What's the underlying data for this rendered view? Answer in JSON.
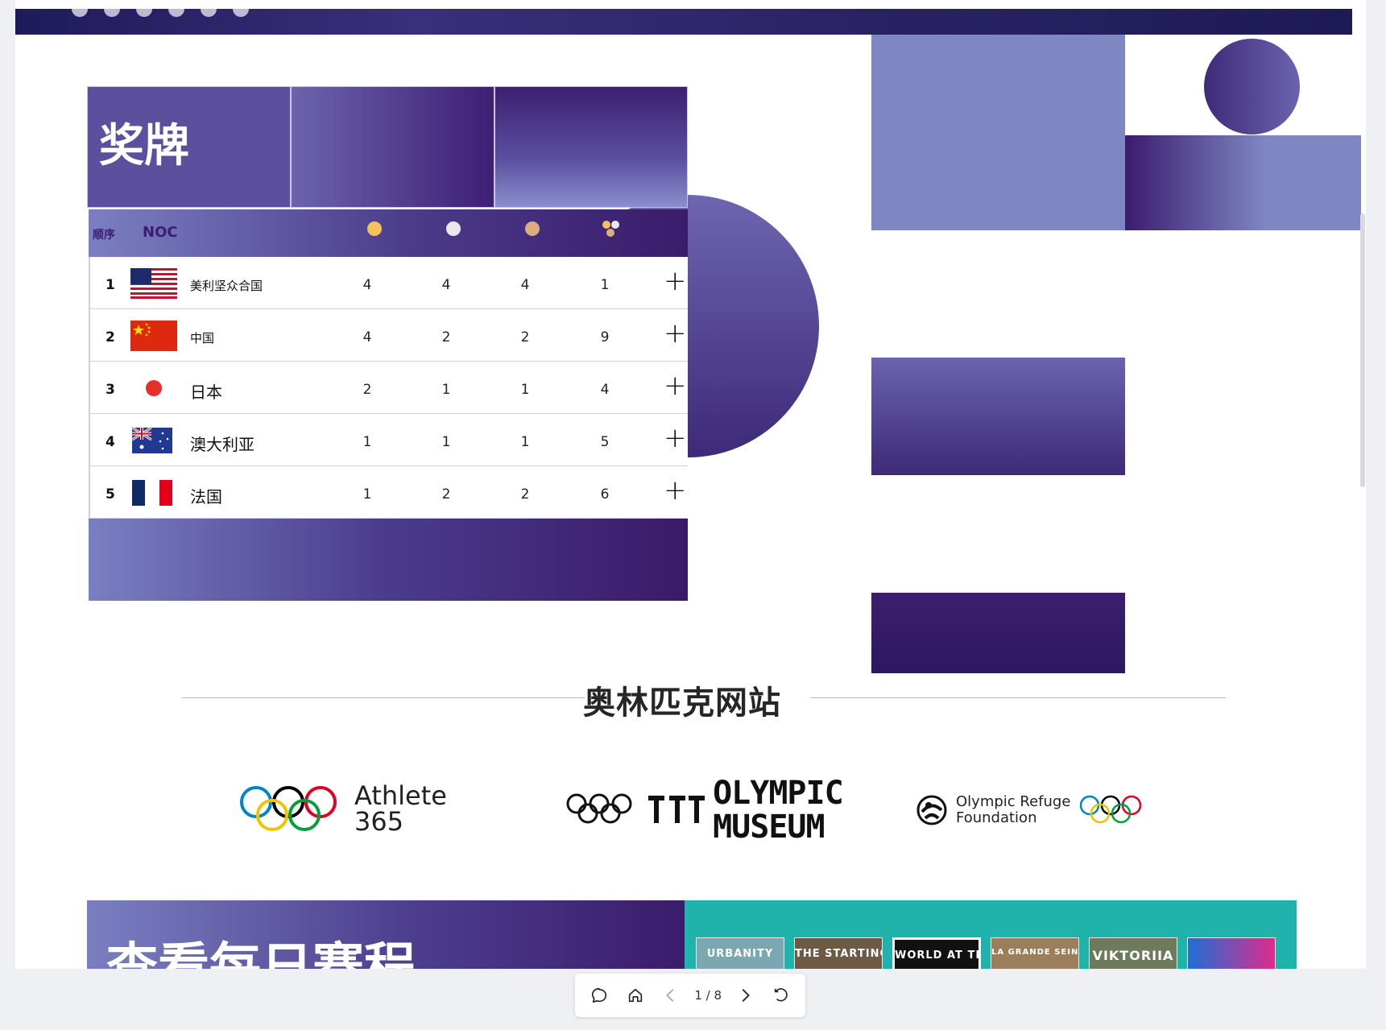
{
  "medals": {
    "title": "奖牌",
    "columns": {
      "rank": "顺序",
      "noc": "NOC"
    },
    "rows": [
      {
        "rank": "1",
        "country": "美利坚众合国",
        "gold": "4",
        "silver": "4",
        "bronze": "4",
        "total": "1"
      },
      {
        "rank": "2",
        "country": "中国",
        "gold": "4",
        "silver": "2",
        "bronze": "2",
        "total": "9"
      },
      {
        "rank": "3",
        "country": "日本",
        "gold": "2",
        "silver": "1",
        "bronze": "1",
        "total": "4"
      },
      {
        "rank": "4",
        "country": "澳大利亚",
        "gold": "1",
        "silver": "1",
        "bronze": "1",
        "total": "5"
      },
      {
        "rank": "5",
        "country": "法国",
        "gold": "1",
        "silver": "2",
        "bronze": "2",
        "total": "6"
      }
    ],
    "expand_symbol": "+"
  },
  "sites": {
    "title": "奥林匹克网站",
    "athlete": {
      "line1": "Athlete",
      "line2": "365"
    },
    "museum": {
      "line1": "OLYMPIC",
      "line2": "MUSEUM"
    },
    "refuge": {
      "line1": "Olympic Refuge",
      "line2": "Foundation"
    }
  },
  "schedule": {
    "title": "查看每日赛程"
  },
  "thumbnails": [
    "URBANITY",
    "THE STARTING",
    "WORLD AT THEIR FEET",
    "LA GRANDE SEINE",
    "VIKTORIIA",
    ""
  ],
  "toolbar": {
    "page": "1 / 8"
  },
  "colors": {
    "purple_dark": "#3a1c6b",
    "purple_light": "#7f87c3",
    "teal": "#1fb3ab",
    "gold": "#f4c25d",
    "silver": "#e8e8ec",
    "bronze": "#dcae7f"
  }
}
